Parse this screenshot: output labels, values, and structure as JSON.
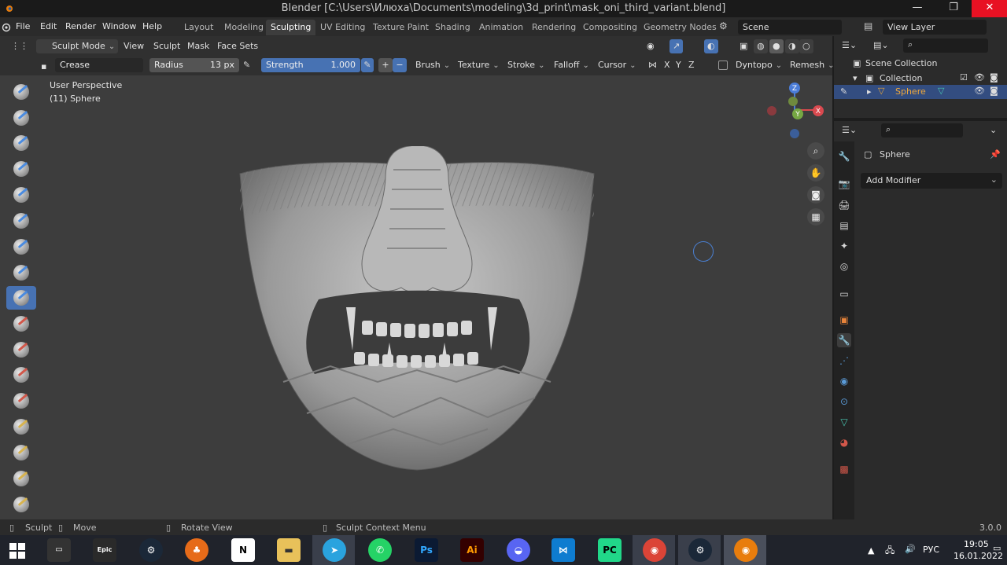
{
  "window": {
    "title": "Blender [C:\\Users\\Илюха\\Documents\\modeling\\3d_print\\mask_oni_third_variant.blend]",
    "minimize": "—",
    "maximize": "❐",
    "close": "✕"
  },
  "menu": [
    "File",
    "Edit",
    "Render",
    "Window",
    "Help"
  ],
  "workspaces": [
    "Layout",
    "Modeling",
    "Sculpting",
    "UV Editing",
    "Texture Paint",
    "Shading",
    "Animation",
    "Rendering",
    "Compositing",
    "Geometry Nodes"
  ],
  "active_workspace": "Sculpting",
  "scene": {
    "label": "Scene",
    "view_layer": "View Layer"
  },
  "header": {
    "mode": "Sculpt Mode",
    "menus": [
      "View",
      "Sculpt",
      "Mask",
      "Face Sets"
    ]
  },
  "tool_settings": {
    "brush_name": "Crease",
    "radius_label": "Radius",
    "radius_value": "13 px",
    "strength_label": "Strength",
    "strength_value": "1.000",
    "plus": "+",
    "minus": "−",
    "dropdowns": [
      "Brush",
      "Texture",
      "Stroke",
      "Falloff",
      "Cursor"
    ],
    "axes": [
      "X",
      "Y",
      "Z"
    ],
    "dyntopo": "Dyntopo",
    "remesh": "Remesh"
  },
  "viewport": {
    "perspective": "User Perspective",
    "object": "(11) Sphere",
    "gizmo": {
      "z": "Z",
      "y": "Y",
      "x": "X"
    }
  },
  "statusbar": {
    "left1": "Sculpt",
    "left2": "Move",
    "left3": "Rotate View",
    "left4": "Sculpt Context Menu",
    "version": "3.0.0"
  },
  "outliner": {
    "scene_collection": "Scene Collection",
    "collection": "Collection",
    "object": "Sphere"
  },
  "properties": {
    "object_name": "Sphere",
    "add_modifier": "Add Modifier"
  },
  "taskbar": {
    "apps": [
      "Epic Games",
      "Steam",
      "FL Studio",
      "Notion",
      "Files",
      "Telegram",
      "WhatsApp",
      "Photoshop",
      "Illustrator",
      "Discord",
      "VS Code",
      "PyCharm",
      "Chrome",
      "Steam",
      "Blender"
    ],
    "lang": "РУС",
    "time": "19:05",
    "date": "16.01.2022"
  },
  "colors": {
    "accent": "#4772b3",
    "viewport_bg": "#3d3d3d",
    "close_red": "#e81123"
  }
}
